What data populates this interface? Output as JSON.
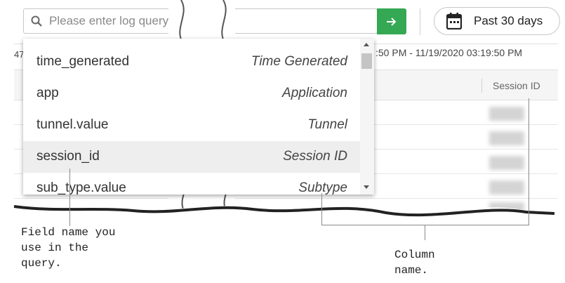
{
  "search": {
    "placeholder": "Please enter log query"
  },
  "time_picker": {
    "label": "Past 30 days"
  },
  "range": {
    "left_fragment": "47",
    "text": ":50 PM - 11/19/2020 03:19:50 PM"
  },
  "table": {
    "column_header": "Session ID"
  },
  "dropdown": {
    "items": [
      {
        "field": "time_generated",
        "column": "Time Generated"
      },
      {
        "field": "app",
        "column": "Application"
      },
      {
        "field": "tunnel.value",
        "column": "Tunnel"
      },
      {
        "field": "session_id",
        "column": "Session ID"
      },
      {
        "field": "sub_type.value",
        "column": "Subtype"
      }
    ]
  },
  "annotations": {
    "field_name": "Field name you\nuse in the\nquery.",
    "column_name": "Column\nname."
  },
  "colors": {
    "go_button": "#34a853"
  }
}
